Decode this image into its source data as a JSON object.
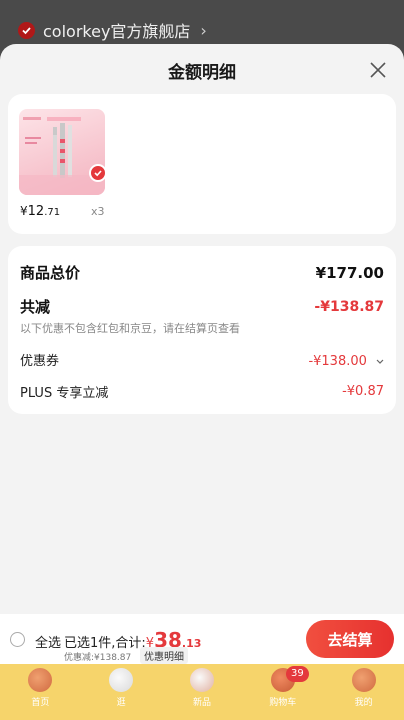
{
  "store": {
    "name": "colorkey官方旗舰店",
    "chevron": "›"
  },
  "sheet": {
    "title": "金额明细"
  },
  "product": {
    "currency": "¥",
    "price_int": "12",
    "price_dec": ".71",
    "qty": "x3"
  },
  "summary": {
    "total_label": "商品总价",
    "total_value": "¥177.00",
    "reduce_label": "共减",
    "reduce_value": "-¥138.87",
    "note": "以下优惠不包含红包和京豆，请在结算页查看",
    "coupon_label": "优惠券",
    "coupon_value": "-¥138.00",
    "plus_label": "PLUS 专享立减",
    "plus_value": "-¥0.87"
  },
  "bottom": {
    "select_all": "全选",
    "selected_text": "已选1件,合计:",
    "currency": "¥",
    "total_big": "38",
    "total_small": ".13",
    "discount_text": "优惠减:¥138.87",
    "detail_link": "优惠明细",
    "checkout": "去结算"
  },
  "tabs": [
    {
      "label": "首页"
    },
    {
      "label": "逛"
    },
    {
      "label": "新品"
    },
    {
      "label": "购物车",
      "badge": "39"
    },
    {
      "label": "我的"
    }
  ],
  "colors": {
    "accent": "#e4393c",
    "tabbar": "#f6d46b"
  }
}
